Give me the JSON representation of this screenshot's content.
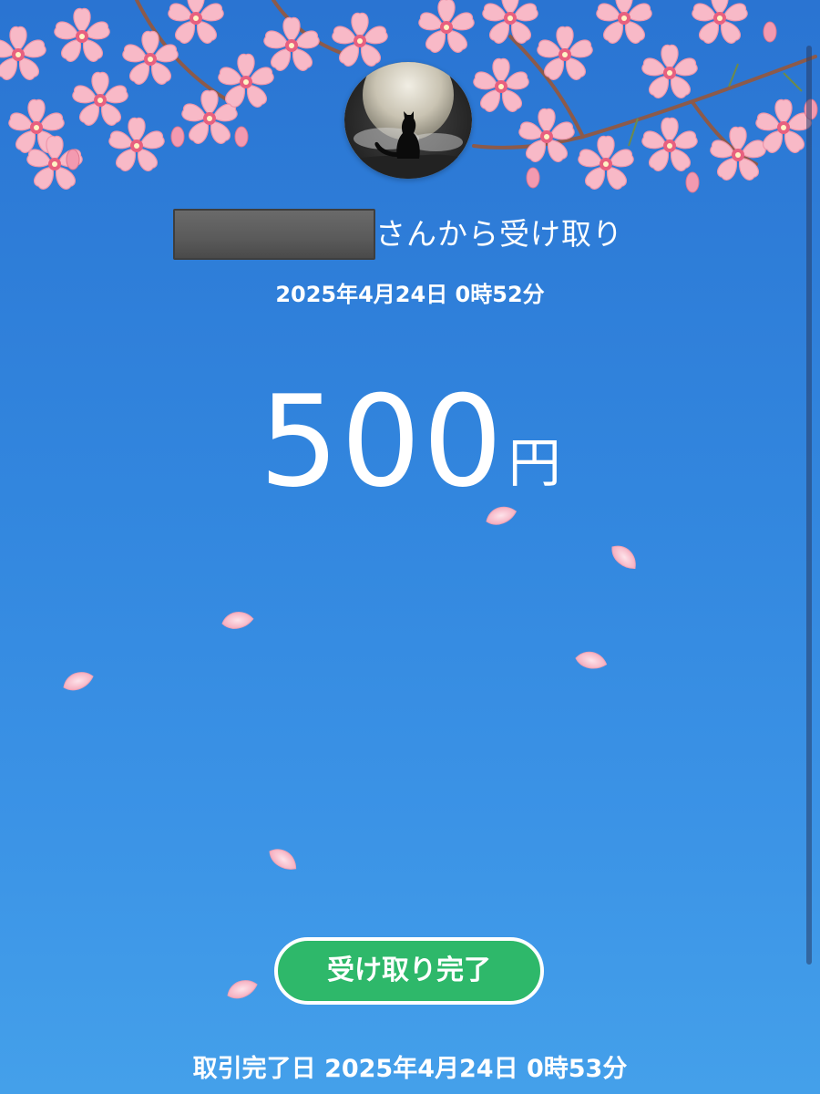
{
  "receipt": {
    "sender_suffix": "さんから受け取り",
    "received_datetime": "2025年4月24日 0時52分",
    "amount_value": "500",
    "amount_unit": "円",
    "status_label": "受け取り完了",
    "completed_label": "取引完了日",
    "completed_datetime": "2025年4月24日 0時53分"
  },
  "avatar": {
    "image": "black cat silhouette in front of full moon"
  },
  "icons": [
    "cherry-blossom-branch",
    "falling-petal"
  ],
  "colors": {
    "background_top": "#2a74d2",
    "background_bottom": "#44a0ea",
    "status_green": "#2eb86a",
    "blossom_pink": "#f7b5c4",
    "text": "#ffffff"
  }
}
